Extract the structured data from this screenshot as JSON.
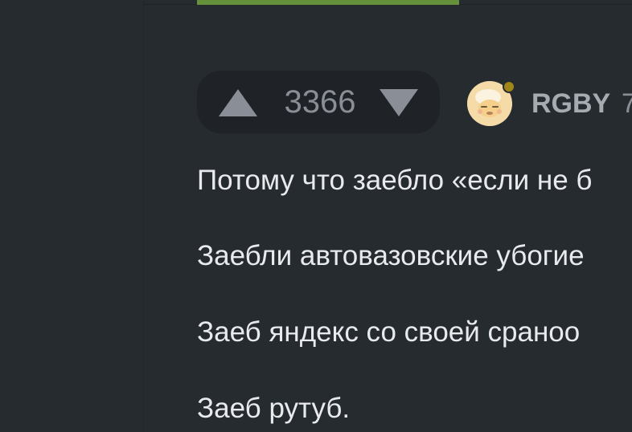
{
  "vote": {
    "count": "3366"
  },
  "author": {
    "username": "RGBY",
    "time_partial": "7"
  },
  "post": {
    "paragraphs": [
      "Потому что заебло «если не б",
      "Заебли автовазовские убогие",
      "Заеб яндекс со своей сраноо",
      "Заеб рутуб."
    ]
  },
  "colors": {
    "accent_green": "#65913d",
    "badge": "#9f8619",
    "background": "#262b30"
  },
  "icons": {
    "upvote": "triangle-up",
    "downvote": "triangle-down",
    "avatar": "cartoon-face"
  }
}
